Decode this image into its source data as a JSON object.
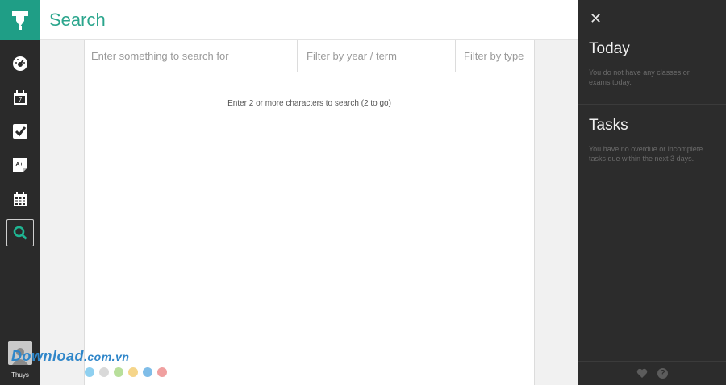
{
  "header": {
    "title": "Search"
  },
  "search": {
    "query_placeholder": "Enter something to search for",
    "year_placeholder": "Filter by year / term",
    "type_placeholder": "Filter by type",
    "hint": "Enter 2 or more characters to search (2 to go)"
  },
  "sidebar": {
    "items": [
      {
        "icon": "dashboard-icon"
      },
      {
        "icon": "calendar-icon"
      },
      {
        "icon": "tasks-check-icon"
      },
      {
        "icon": "notes-icon"
      },
      {
        "icon": "timetable-icon"
      },
      {
        "icon": "search-icon"
      }
    ],
    "user_name": "Thuys"
  },
  "right_panel": {
    "today_title": "Today",
    "today_text": "You do not have any classes or exams today.",
    "tasks_title": "Tasks",
    "tasks_text": "You have no overdue or incomplete tasks due within the next 3 days."
  },
  "watermark": {
    "main": "Download",
    "tail": ".com.vn"
  },
  "colors": {
    "accent": "#1f9e86",
    "dots": [
      "#8fd0f0",
      "#d9d9d9",
      "#b8df9b",
      "#f5d58a",
      "#7fbde8",
      "#f0a0a0"
    ]
  }
}
